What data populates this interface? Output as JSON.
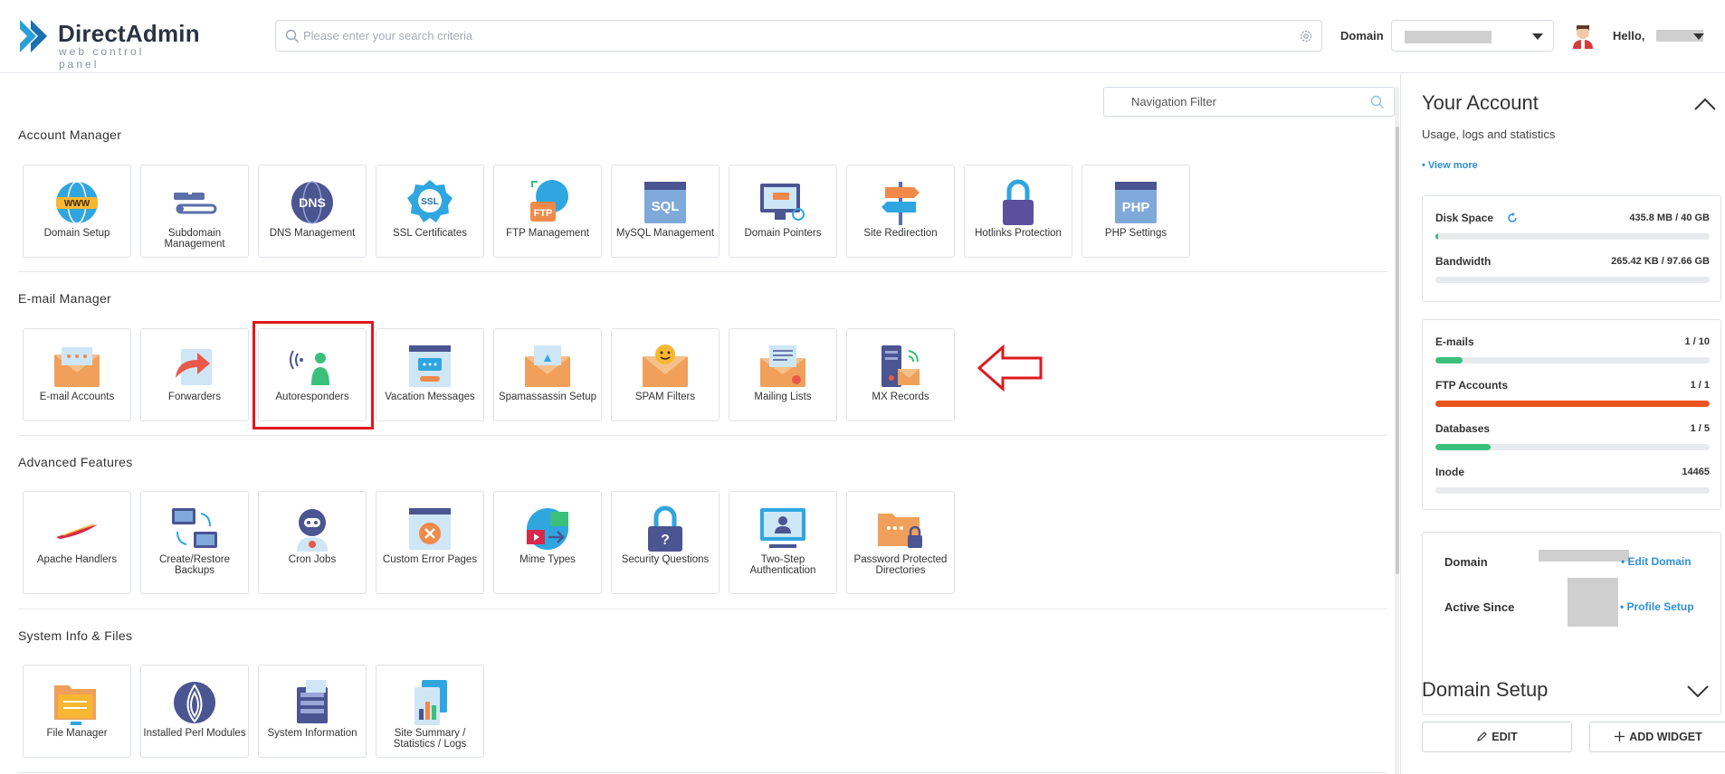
{
  "header": {
    "logo_name": "DirectAdmin",
    "logo_sub": "web control panel",
    "search_placeholder": "Please enter your search criteria",
    "domain_label": "Domain",
    "hello": "Hello,"
  },
  "nav_filter_placeholder": "Navigation Filter",
  "sections": {
    "account": {
      "title": "Account Manager",
      "items": [
        "Domain Setup",
        "Subdomain Management",
        "DNS Management",
        "SSL Certificates",
        "FTP Management",
        "MySQL Management",
        "Domain Pointers",
        "Site Redirection",
        "Hotlinks Protection",
        "PHP Settings"
      ]
    },
    "email": {
      "title": "E-mail Manager",
      "items": [
        "E-mail Accounts",
        "Forwarders",
        "Autoresponders",
        "Vacation Messages",
        "Spamassassin Setup",
        "SPAM Filters",
        "Mailing Lists",
        "MX Records"
      ]
    },
    "advanced": {
      "title": "Advanced Features",
      "items": [
        "Apache Handlers",
        "Create/Restore Backups",
        "Cron Jobs",
        "Custom Error Pages",
        "Mime Types",
        "Security Questions",
        "Two-Step Authentication",
        "Password Protected Directories"
      ]
    },
    "system": {
      "title": "System Info & Files",
      "items": [
        "File Manager",
        "Installed Perl Modules",
        "System Information",
        "Site Summary / Statistics / Logs"
      ]
    }
  },
  "sidebar": {
    "title": "Your Account",
    "subtitle": "Usage, logs and statistics",
    "view_more": "• View more",
    "usage": [
      {
        "name": "Disk Space",
        "value": "435.8 MB / 40 GB",
        "fraction": 0.01,
        "color": "#3bbf7c"
      },
      {
        "name": "Bandwidth",
        "value": "265.42 KB / 97.66 GB",
        "fraction": 0.0,
        "color": "#3bbf7c"
      }
    ],
    "limits": [
      {
        "name": "E-mails",
        "value": "1 / 10",
        "fraction": 0.1,
        "color": "#3bbf7c"
      },
      {
        "name": "FTP Accounts",
        "value": "1 / 1",
        "fraction": 1.0,
        "color": "#e9541f"
      },
      {
        "name": "Databases",
        "value": "1 / 5",
        "fraction": 0.2,
        "color": "#3bbf7c"
      },
      {
        "name": "Inode",
        "value": "14465",
        "fraction": 0.0,
        "color": "#3bbf7c"
      }
    ],
    "info": {
      "domain_label": "Domain",
      "edit_domain": "• Edit Domain",
      "active_label": "Active Since",
      "profile_setup": "• Profile Setup"
    },
    "widget_title": "Domain Setup",
    "edit_button": "EDIT",
    "add_widget_button": "ADD WIDGET"
  },
  "colors": {
    "accent": "#2f8fd8",
    "highlight": "#e0181e",
    "brand": "#2a3341"
  }
}
